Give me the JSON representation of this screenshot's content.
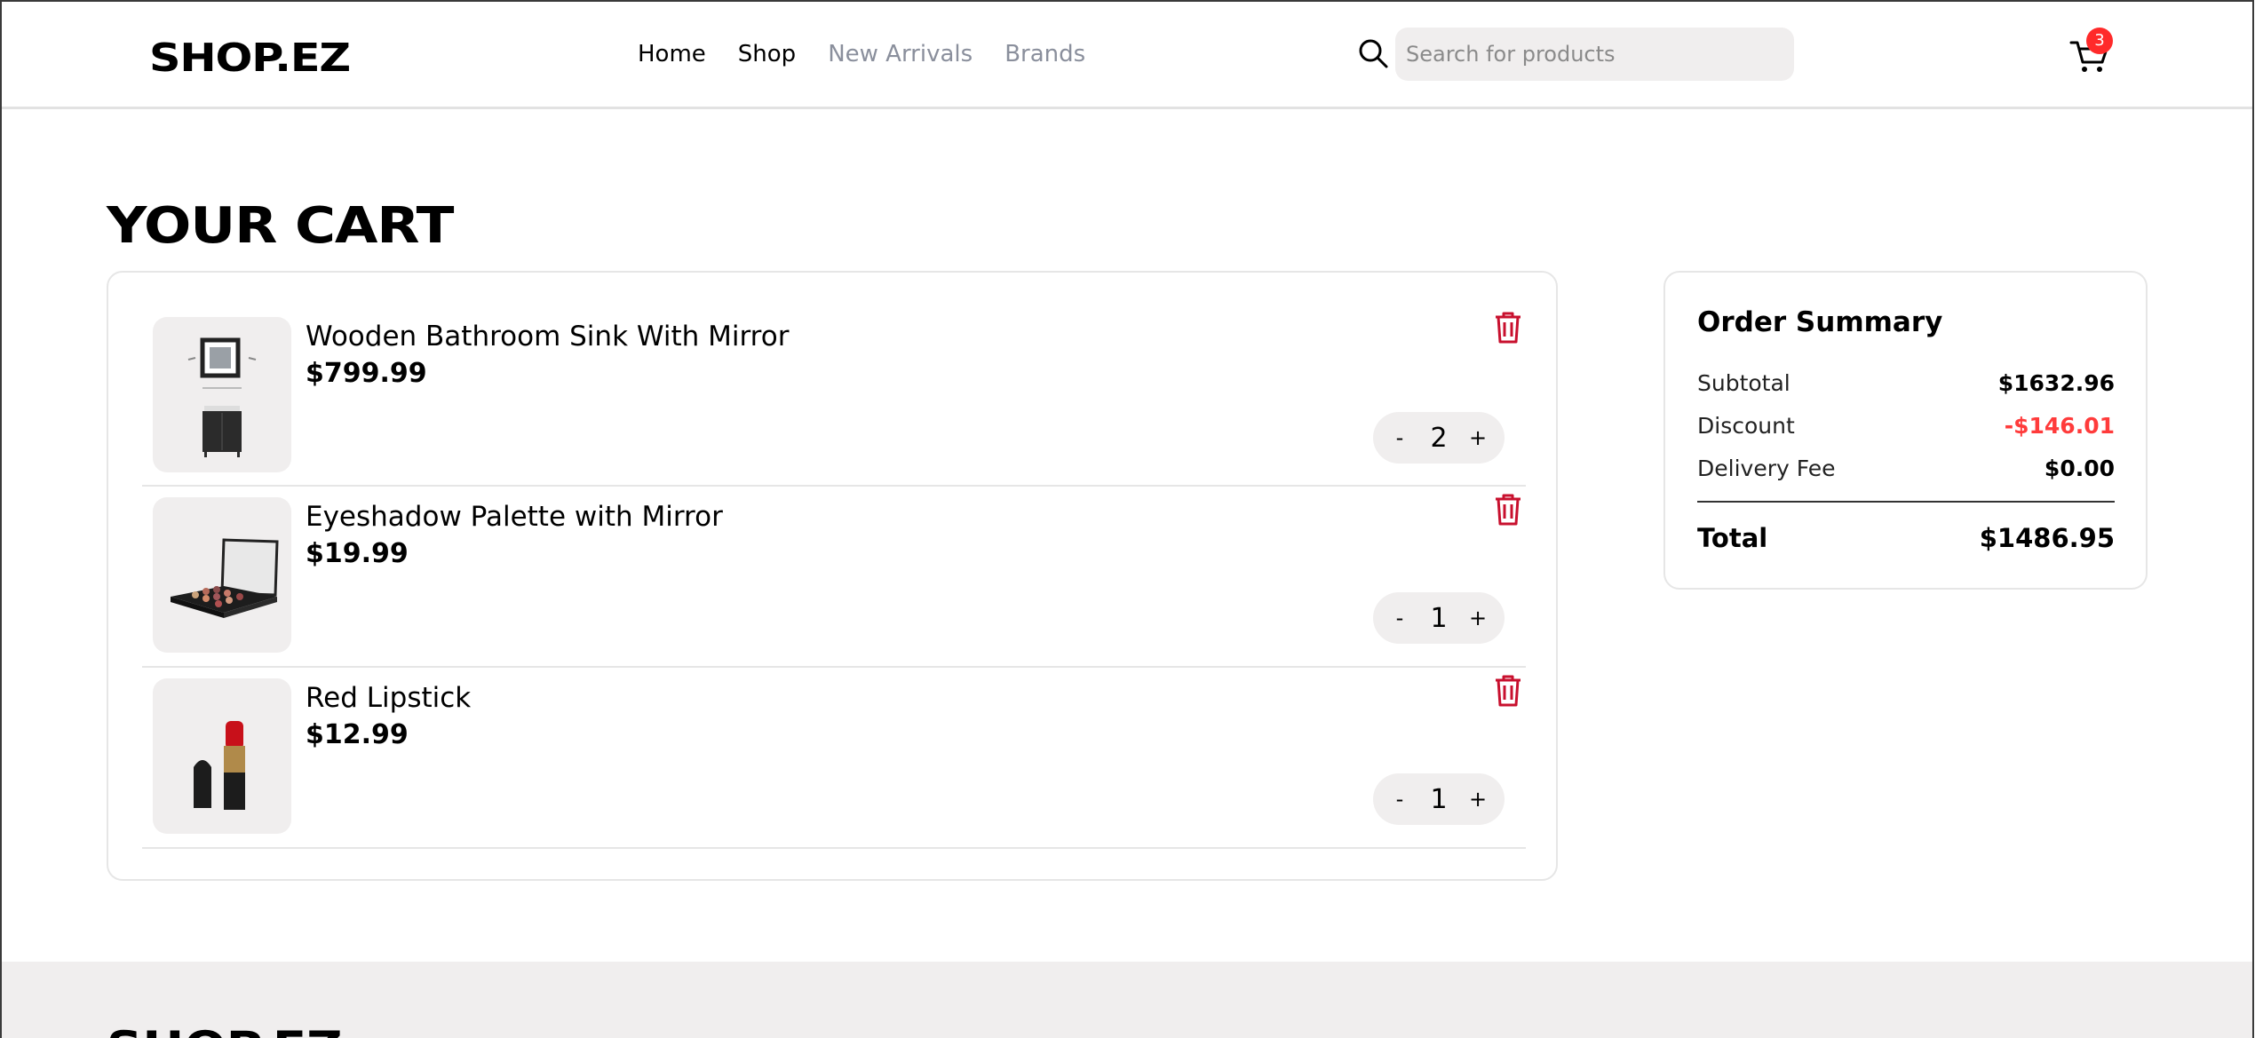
{
  "header": {
    "logo": "SHOP.EZ",
    "nav": [
      {
        "label": "Home",
        "state": "active"
      },
      {
        "label": "Shop",
        "state": "active"
      },
      {
        "label": "New Arrivals",
        "state": "muted"
      },
      {
        "label": "Brands",
        "state": "muted"
      }
    ],
    "search_placeholder": "Search for products",
    "cart_count": "3"
  },
  "page_title": "YOUR CART",
  "cart": {
    "items": [
      {
        "name": "Wooden Bathroom Sink With Mirror",
        "price": "$799.99",
        "qty": "2",
        "minus": "-",
        "plus": "+",
        "image": "bathroom-sink-image"
      },
      {
        "name": "Eyeshadow Palette with Mirror",
        "price": "$19.99",
        "qty": "1",
        "minus": "-",
        "plus": "+",
        "image": "eyeshadow-palette-image"
      },
      {
        "name": "Red Lipstick",
        "price": "$12.99",
        "qty": "1",
        "minus": "-",
        "plus": "+",
        "image": "lipstick-image"
      }
    ]
  },
  "summary": {
    "title": "Order Summary",
    "subtotal_label": "Subtotal",
    "subtotal": "$1632.96",
    "discount_label": "Discount",
    "discount": "-$146.01",
    "delivery_label": "Delivery Fee",
    "delivery": "$0.00",
    "total_label": "Total",
    "total": "$1486.95"
  },
  "footer": {
    "logo": "SHOP.EZ"
  },
  "colors": {
    "accent_red": "#ff3b3b",
    "trash_red": "#c8102e",
    "badge": "#ff2a2a",
    "muted_nav": "#8a8f9c",
    "panel_bg": "#f0eeee"
  }
}
